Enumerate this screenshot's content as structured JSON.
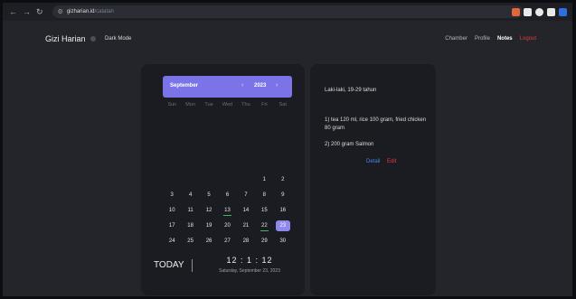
{
  "browser": {
    "host": "gizharian.id",
    "path": "/catatan"
  },
  "nav": {
    "brand": "Gizi Harian",
    "dark_mode_label": "Dark Mode",
    "menu": [
      "Chamber",
      "Profile",
      "Notes",
      "Logout"
    ],
    "active_menu": "Notes"
  },
  "calendar": {
    "month": "September",
    "year": "2023",
    "weekdays": [
      "Sun",
      "Mon",
      "Tue",
      "Wed",
      "Thu",
      "Fri",
      "Sat"
    ],
    "leading_empty_days": 5,
    "days": [
      "1",
      "2",
      "3",
      "4",
      "5",
      "6",
      "7",
      "8",
      "9",
      "10",
      "11",
      "12",
      "13",
      "14",
      "15",
      "16",
      "17",
      "18",
      "19",
      "20",
      "21",
      "22",
      "23",
      "24",
      "25",
      "26",
      "27",
      "28",
      "29",
      "30"
    ],
    "marked_days": [
      "13",
      "22"
    ],
    "selected_day": "23",
    "today_label": "TODAY",
    "clock": "12 : 1 : 12",
    "date_text": "Saturday, September 23, 2023"
  },
  "notes": {
    "group": "Laki-laki, 19-29 tahun",
    "entries": [
      "1) tea 120 ml, rice 100 gram, fried chicken 80 gram",
      "2) 200 gram Salmon"
    ],
    "detail_label": "Detail",
    "edit_label": "Edit"
  },
  "colors": {
    "accent": "#7b74e8",
    "selected_day": "#8f89ee",
    "mark": "#3fb56b",
    "link": "#4a87e8",
    "danger": "#e23b3b"
  }
}
